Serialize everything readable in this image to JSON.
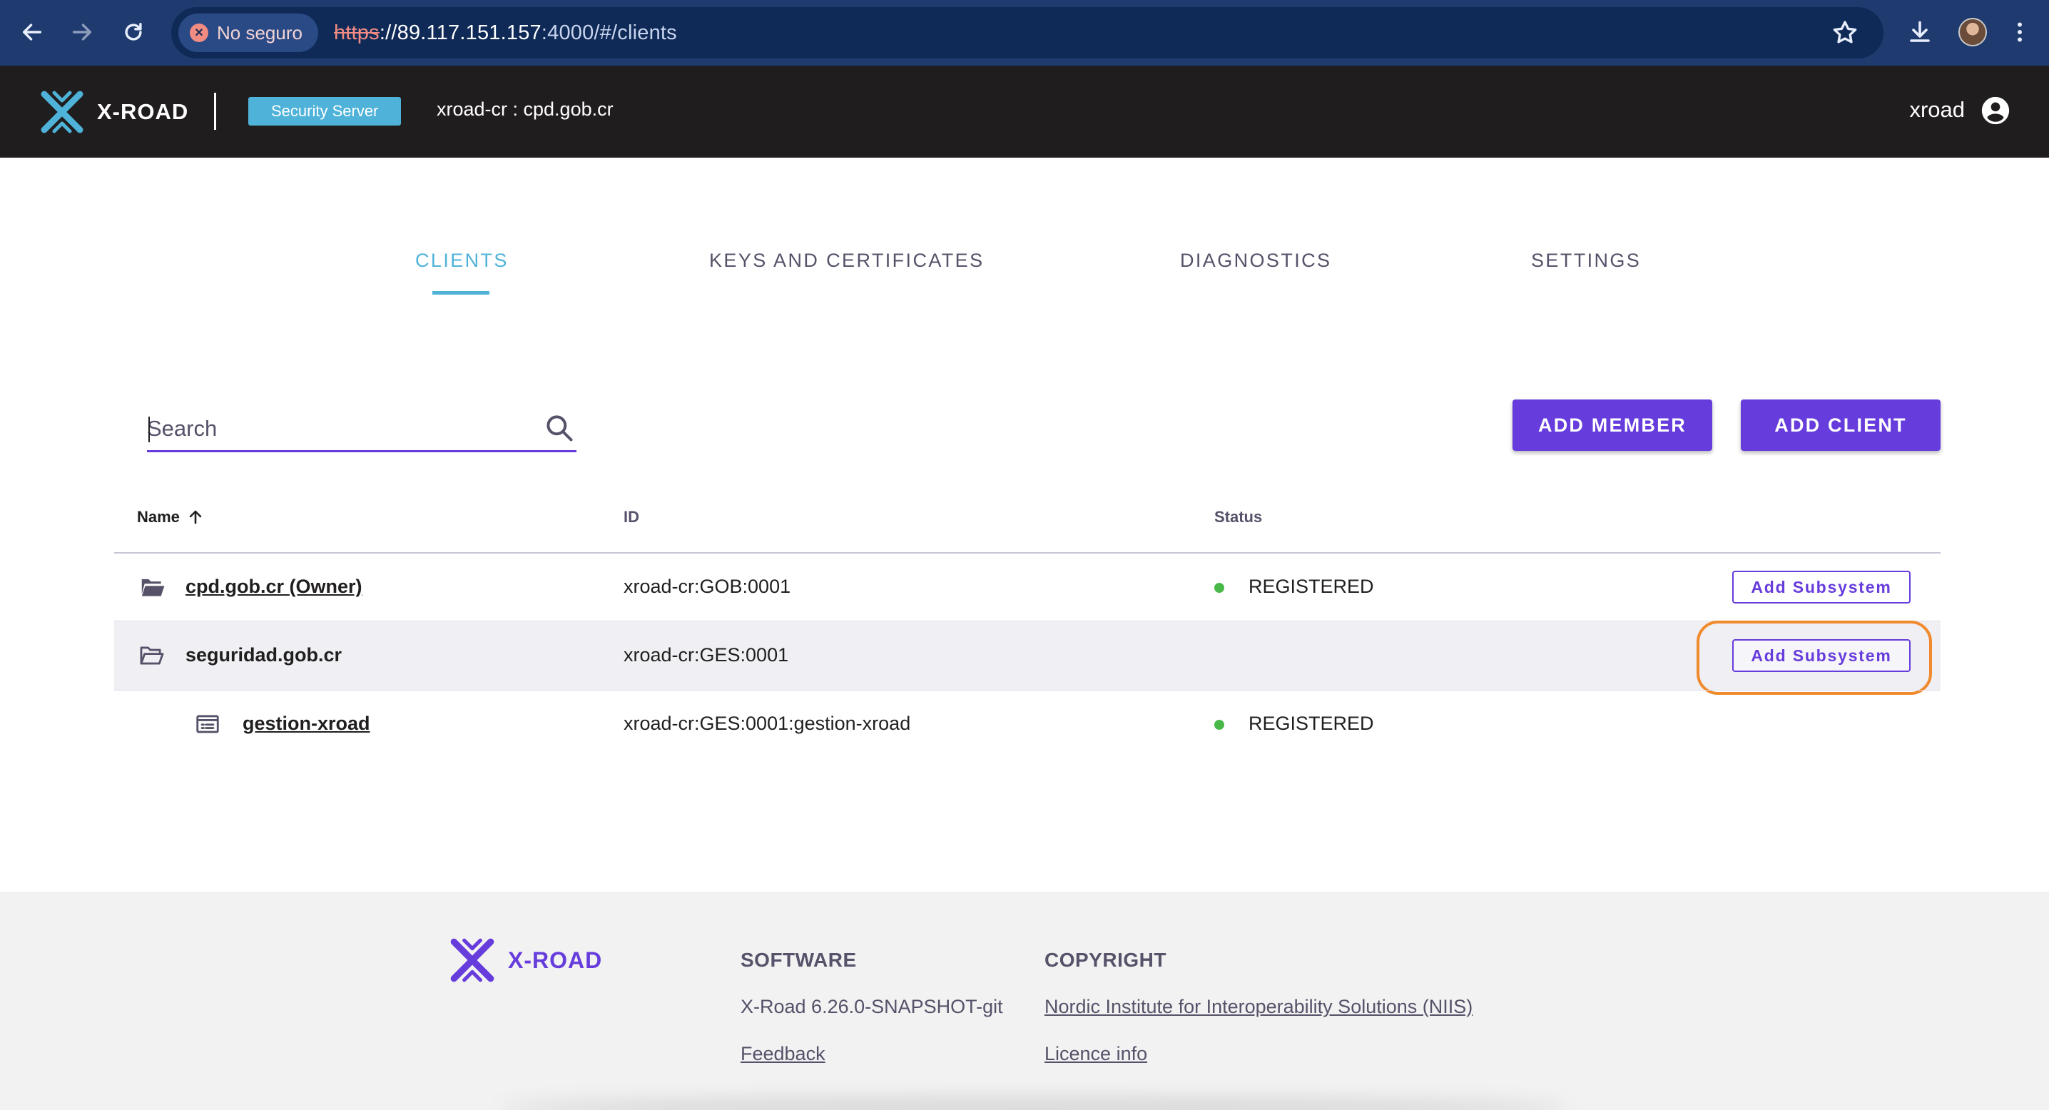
{
  "browser": {
    "back_icon": "arrow-left-icon",
    "insecure_label": "No seguro",
    "url_scheme": "https",
    "url_host": "://89.117.151.157",
    "url_path": ":4000/#/clients"
  },
  "header": {
    "logo_text": "X-ROAD",
    "server_badge": "Security Server",
    "server_id": "xroad-cr : cpd.gob.cr",
    "user_name": "xroad"
  },
  "tabs": [
    {
      "label": "CLIENTS",
      "active": true
    },
    {
      "label": "KEYS AND CERTIFICATES",
      "active": false
    },
    {
      "label": "DIAGNOSTICS",
      "active": false
    },
    {
      "label": "SETTINGS",
      "active": false
    }
  ],
  "search": {
    "placeholder": "Search"
  },
  "actions": {
    "add_member": "ADD MEMBER",
    "add_client": "ADD CLIENT"
  },
  "table": {
    "headers": {
      "name": "Name",
      "id": "ID",
      "status": "Status"
    },
    "rows": [
      {
        "name": "cpd.gob.cr (Owner)",
        "id": "xroad-cr:GOB:0001",
        "status": "REGISTERED",
        "action": "Add Subsystem",
        "icon": "folder-icon"
      },
      {
        "name": "seguridad.gob.cr",
        "id": "xroad-cr:GES:0001",
        "status": "",
        "action": "Add Subsystem",
        "icon": "folder-open-icon"
      },
      {
        "name": "gestion-xroad",
        "id": "xroad-cr:GES:0001:gestion-xroad",
        "status": "REGISTERED",
        "action": "",
        "icon": "subsystem-icon"
      }
    ]
  },
  "footer": {
    "logo_text": "X-ROAD",
    "software_heading": "SOFTWARE",
    "version": "X-Road 6.26.0-SNAPSHOT-git",
    "feedback": "Feedback",
    "copyright_heading": "COPYRIGHT",
    "niis": "Nordic Institute for Interoperability Solutions (NIIS)",
    "licence": "Licence info"
  },
  "colors": {
    "primary": "#663cdc",
    "accent": "#4fb3d9",
    "header_bg": "#201d1e",
    "status_ok": "#0ca00c",
    "highlight": "#f08a2c"
  }
}
